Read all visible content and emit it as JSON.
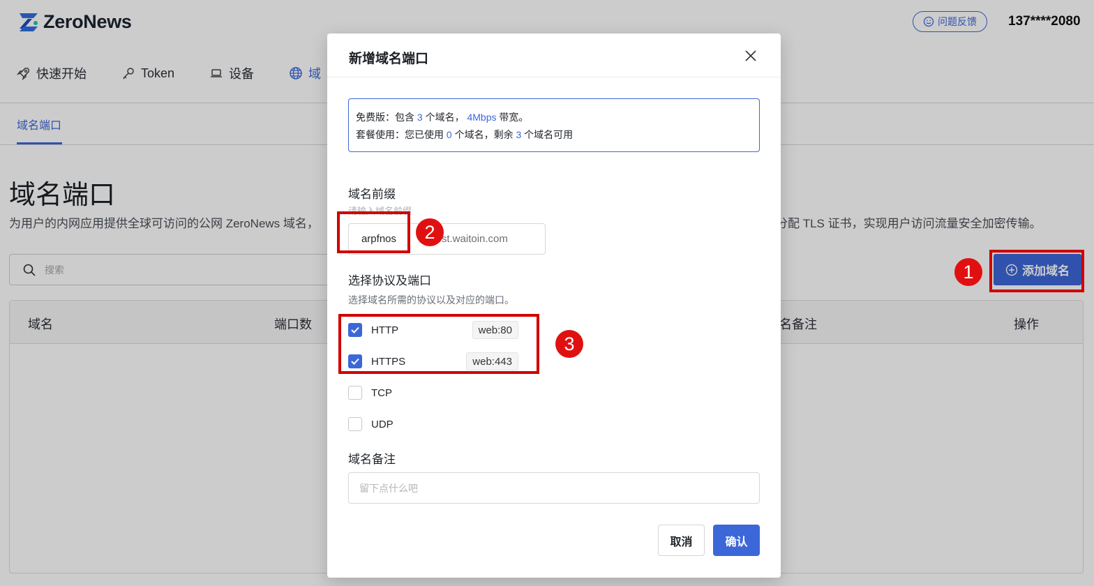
{
  "header": {
    "brand": "ZeroNews",
    "feedback_label": "问题反馈",
    "user_phone": "137****2080"
  },
  "nav": {
    "items": [
      {
        "label": "快速开始",
        "icon": "rocket-icon"
      },
      {
        "label": "Token",
        "icon": "key-icon"
      },
      {
        "label": "设备",
        "icon": "laptop-icon"
      },
      {
        "label": "域",
        "icon": "globe-icon"
      }
    ]
  },
  "subtab": {
    "label": "域名端口"
  },
  "main": {
    "title": "域名端口",
    "description_left": "为用户的内网应用提供全球可访问的公网 ZeroNews 域名，",
    "description_right": "分配 TLS 证书，实现用户访问流量安全加密传输。",
    "search_placeholder": "搜索",
    "add_button": "添加域名"
  },
  "table": {
    "columns": [
      "域名",
      "端口数",
      "名备注",
      "操作"
    ]
  },
  "modal": {
    "title": "新增域名端口",
    "plan": {
      "line1_prefix": "免费版：包含",
      "domain_count": "3",
      "line1_mid": "个域名，",
      "bandwidth": "4Mbps",
      "line1_suffix": "带宽。",
      "line2_prefix": "套餐使用：您已使用",
      "used": "0",
      "line2_mid": "个域名，剩余",
      "remaining": "3",
      "line2_suffix": "个域名可用"
    },
    "prefix": {
      "label": "域名前缀",
      "hint": "请输入域名前缀",
      "value": "arpfnos",
      "suffix": "ptest.waitoin.com"
    },
    "protocol": {
      "label": "选择协议及端口",
      "hint": "选择域名所需的协议以及对应的端口。",
      "options": [
        {
          "label": "HTTP",
          "checked": true,
          "port": "web:80"
        },
        {
          "label": "HTTPS",
          "checked": true,
          "port": "web:443"
        },
        {
          "label": "TCP",
          "checked": false,
          "port": ""
        },
        {
          "label": "UDP",
          "checked": false,
          "port": ""
        }
      ]
    },
    "remark": {
      "label": "域名备注",
      "placeholder": "留下点什么吧"
    },
    "cancel_label": "取消",
    "confirm_label": "确认"
  },
  "annotations": [
    "1",
    "2",
    "3"
  ],
  "colors": {
    "accent": "#3c67d8",
    "annotation": "#d10000"
  }
}
